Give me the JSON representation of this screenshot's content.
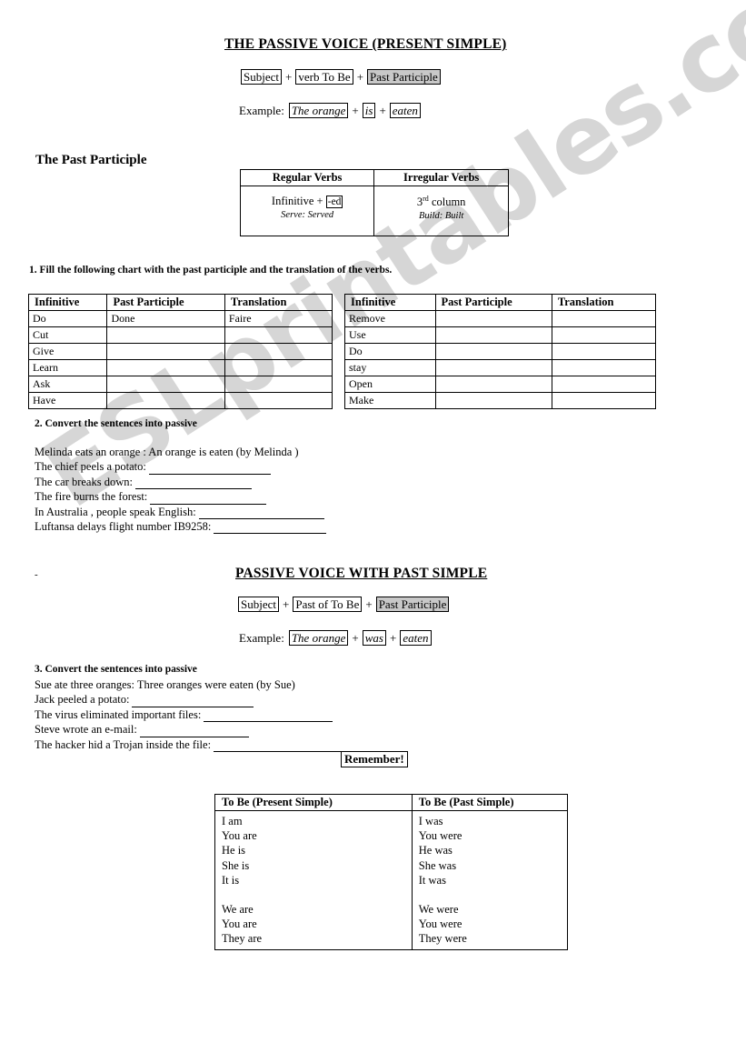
{
  "watermark": {
    "text": "ESLprintables.com"
  },
  "title": "THE PASSIVE VOICE (PRESENT SIMPLE)",
  "present_formula": {
    "subject": "Subject",
    "plus1": "+",
    "verb_to_be": "verb To Be",
    "plus2": "+",
    "past_participle": "Past Participle"
  },
  "present_example": {
    "label": "Example:",
    "subject": "The orange",
    "plus1": "+",
    "be": "is",
    "plus2": "+",
    "participle": "eaten"
  },
  "past_participle_section": {
    "heading": "The Past Participle",
    "table": {
      "headers": [
        "Regular Verbs",
        "Irregular Verbs"
      ],
      "regular": {
        "rule_prefix": "Infinitive +",
        "rule_suffix": "-ed",
        "example": "Serve: Served"
      },
      "irregular": {
        "rule_number": "3",
        "rule_ordinal": "rd",
        "rule_word": "column",
        "example": "Build: Built"
      }
    }
  },
  "exercise1": {
    "heading": "1. Fill the following chart with the past participle and the translation of the verbs.",
    "headers": [
      "Infinitive",
      "Past Participle",
      "Translation"
    ],
    "left_rows": [
      [
        "Do",
        "Done",
        "Faire"
      ],
      [
        "Cut",
        "",
        ""
      ],
      [
        "Give",
        "",
        ""
      ],
      [
        "Learn",
        "",
        ""
      ],
      [
        "Ask",
        "",
        ""
      ],
      [
        "Have",
        "",
        ""
      ]
    ],
    "right_rows": [
      [
        "Remove",
        "",
        ""
      ],
      [
        "Use",
        "",
        ""
      ],
      [
        "Do",
        "",
        ""
      ],
      [
        "stay",
        "",
        ""
      ],
      [
        "Open",
        "",
        ""
      ],
      [
        "Make",
        "",
        ""
      ]
    ]
  },
  "exercise2": {
    "heading": "2. Convert the sentences into passive",
    "items": [
      {
        "prompt": "Melinda eats an orange  :  An orange is eaten (by Melinda )",
        "blank_width": 0
      },
      {
        "prompt": "The chief  peels a potato:",
        "blank_width": 134
      },
      {
        "prompt": "The car breaks down:",
        "blank_width": 128
      },
      {
        "prompt": "The fire burns the forest:",
        "blank_width": 128
      },
      {
        "prompt": "In Australia , people speak English:",
        "blank_width": 138
      },
      {
        "prompt": "Luftansa delays  flight number IB9258:",
        "blank_width": 124
      }
    ]
  },
  "small_dash": "-",
  "past_title": "PASSIVE VOICE WITH PAST SIMPLE",
  "past_formula": {
    "subject": "Subject",
    "plus1": "+",
    "past_of_to_be": "Past of To Be",
    "plus2": "+",
    "past_participle": "Past Participle"
  },
  "past_example": {
    "label": "Example:",
    "subject": "The orange",
    "plus1": "+",
    "be": "was",
    "plus2": "+",
    "participle": "eaten"
  },
  "exercise3": {
    "heading": "3. Convert the sentences into passive",
    "items": [
      {
        "prompt": "Sue ate three oranges:  Three oranges were eaten (by Sue)",
        "blank_width": 0
      },
      {
        "prompt": "Jack peeled a potato:",
        "blank_width": 134
      },
      {
        "prompt": "The virus eliminated important  files:",
        "blank_width": 142
      },
      {
        "prompt": "Steve wrote an e-mail:",
        "blank_width": 120
      },
      {
        "prompt": "The hacker hid a  Trojan inside the file:",
        "blank_width": 142
      }
    ]
  },
  "remember_label": "Remember!",
  "tobe_table": {
    "headers": [
      "To Be (Present Simple)",
      "To Be (Past Simple)"
    ],
    "present_group1": [
      "I am",
      "You are",
      "He is",
      "She is",
      "It is"
    ],
    "present_group2": [
      "We are",
      "You are",
      "They are"
    ],
    "past_group1": [
      "I was",
      "You were",
      "He was",
      "She was",
      "It was"
    ],
    "past_group2": [
      "We were",
      "You were",
      "They were"
    ]
  }
}
